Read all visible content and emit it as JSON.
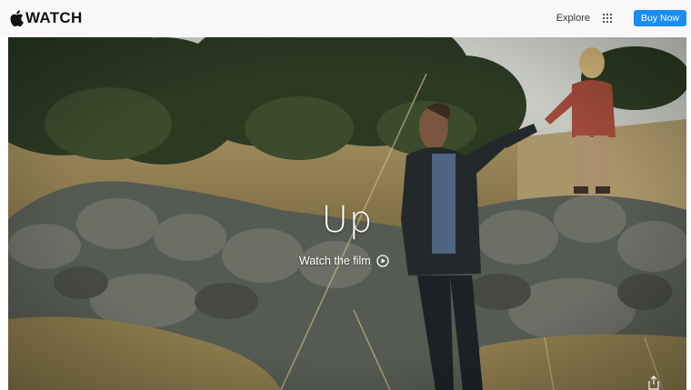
{
  "nav": {
    "brand": "WATCH",
    "brand_icon": "apple-logo-icon",
    "explore_label": "Explore",
    "grid_icon": "grid-menu-icon",
    "buy_label": "Buy Now",
    "accent_color": "#1a8cf0"
  },
  "hero": {
    "title": "Up",
    "cta_label": "Watch the film",
    "cta_icon": "play-circle-icon",
    "share_icon": "share-icon",
    "image_icon": "hero-photo"
  }
}
